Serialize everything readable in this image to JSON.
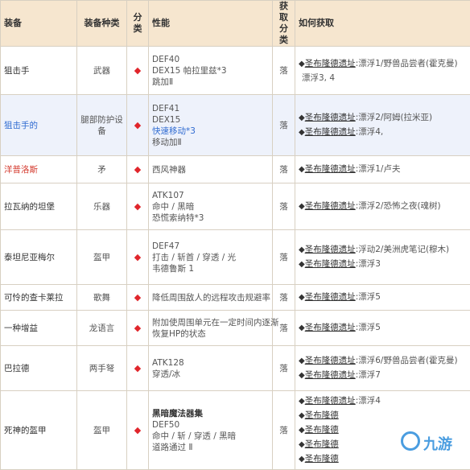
{
  "headers": {
    "equip": "装备",
    "type": "装备种类",
    "cat": "分类",
    "perf": "性能",
    "get_cat": "获取分类",
    "how": "如何获取"
  },
  "marker": "◆",
  "rows": [
    {
      "name": "狙击手",
      "name_color": "normal",
      "type": "武器",
      "perf": [
        "DEF40",
        "DEX15 帕拉里兹*3",
        "跳加Ⅱ"
      ],
      "get": "落",
      "how": [
        {
          "src": "圣布隆德遗址",
          "text": ":漂浮1/野兽品尝者(霍克曼)"
        },
        {
          "src": "",
          "text": "漂浮3, 4"
        }
      ]
    },
    {
      "name": "狙击手的",
      "name_color": "blue",
      "type": "腿部防护设备",
      "perf": [
        "DEF41",
        "DEX15",
        "快速移动*3",
        "移动加Ⅱ"
      ],
      "get": "落",
      "how": [
        {
          "src": "圣布隆德遗址",
          "text": ":漂浮2/阿姆(拉米亚)"
        },
        {
          "src": "圣布隆德遗址",
          "text": ":漂浮4,"
        }
      ]
    },
    {
      "name": "洋普洛斯",
      "name_color": "red",
      "type": "矛",
      "perf": [
        "西风神器"
      ],
      "get": "落",
      "how": [
        {
          "src": "圣布隆德遗址",
          "text": ":漂浮1/卢夫"
        }
      ]
    },
    {
      "name": "拉瓦纳的坦堡",
      "name_color": "normal",
      "type": "乐器",
      "perf": [
        "ATK107",
        "命中 / 黑暗",
        "恐慌索纳特*3"
      ],
      "get": "落",
      "how": [
        {
          "src": "圣布隆德遗址",
          "text": ":漂浮2/恐怖之夜(魂树)"
        }
      ]
    },
    {
      "name": "泰坦尼亚梅尔",
      "name_color": "normal",
      "type": "盔甲",
      "perf": [
        "DEF47",
        "打击 / 斩首 / 穿透 / 光",
        "韦德鲁斯 1"
      ],
      "get": "落",
      "how": [
        {
          "src": "圣布隆德遗址",
          "text": ":浮动2/美洲虎笔记(穆木)"
        },
        {
          "src": "圣布隆德遗址",
          "text": ":漂浮3"
        }
      ]
    },
    {
      "name": "可怜的查卡莱拉",
      "name_color": "normal",
      "type": "歌舞",
      "perf": [
        "降低周围敌人的远程攻击规避率"
      ],
      "get": "落",
      "how": [
        {
          "src": "圣布隆德遗址",
          "text": ":漂浮5"
        }
      ]
    },
    {
      "name": "一种增益",
      "name_color": "normal",
      "type": "龙语言",
      "perf": [
        "附加使周围单元在一定时间内逐渐",
        "恢复HP的状态"
      ],
      "get": "落",
      "how": [
        {
          "src": "圣布隆德遗址",
          "text": ":漂浮5"
        }
      ]
    },
    {
      "name": "巴拉德",
      "name_color": "normal",
      "type": "两手弩",
      "perf": [
        "ATK128",
        "穿透/冰"
      ],
      "get": "落",
      "how": [
        {
          "src": "圣布隆德遗址",
          "text": ":漂浮6/野兽品尝者(霍克曼)"
        },
        {
          "src": "圣布隆德遗址",
          "text": ":漂浮7"
        }
      ]
    },
    {
      "name": "死神的盔甲",
      "name_color": "normal",
      "type": "盔甲",
      "perf": [
        "黑暗魔法器集",
        "DEF50",
        "命中 / 斩 / 穿透 / 黑暗",
        "道路通过 Ⅱ"
      ],
      "get": "落",
      "how": [
        {
          "src": "圣布隆德遗址",
          "text": ":漂浮4"
        },
        {
          "src": "圣布隆德",
          "text": ""
        },
        {
          "src": "圣布隆德",
          "text": ""
        },
        {
          "src": "圣布隆德",
          "text": ""
        },
        {
          "src": "圣布隆德",
          "text": ""
        }
      ]
    }
  ],
  "watermark": "九游",
  "colors": {
    "header_bg": "#f6e6cf",
    "border": "#d8d0c2",
    "diamond": "#e0252b",
    "blue": "#2f6bd1",
    "red": "#d43a2e"
  }
}
